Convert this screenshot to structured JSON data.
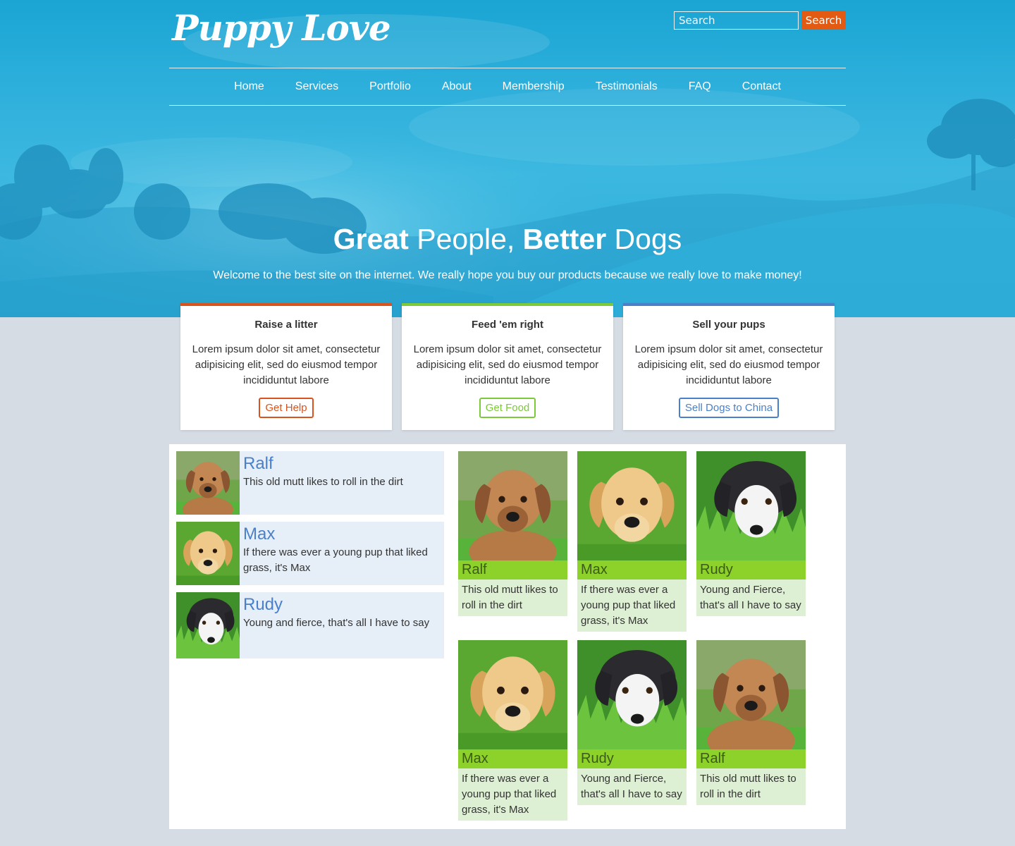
{
  "site": {
    "logo": "Puppy Love",
    "search_placeholder": "Search",
    "search_button": "Search"
  },
  "nav": [
    "Home",
    "Services",
    "Portfolio",
    "About",
    "Membership",
    "Testimonials",
    "FAQ",
    "Contact"
  ],
  "hero": {
    "headline_bold_1": "Great",
    "headline_normal_1": " People, ",
    "headline_bold_2": "Better",
    "headline_normal_2": " Dogs",
    "tagline": "Welcome to the best site on the internet. We really hope you buy our products because we really love to make money!"
  },
  "cards": [
    {
      "title": "Raise a litter",
      "body": "Lorem ipsum dolor sit amet, consectetur adipisicing elit, sed do eiusmod tempor incididuntut labore",
      "button": "Get Help",
      "color": "#d9531e"
    },
    {
      "title": "Feed 'em right",
      "body": "Lorem ipsum dolor sit amet, consectetur adipisicing elit, sed do eiusmod tempor incididuntut labore",
      "button": "Get Food",
      "color": "#7cc93a"
    },
    {
      "title": "Sell your pups",
      "body": "Lorem ipsum dolor sit amet, consectetur adipisicing elit, sed do eiusmod tempor incididuntut labore",
      "button": "Sell Dogs to China",
      "color": "#4a80c9"
    }
  ],
  "list": [
    {
      "name": "Ralf",
      "desc": "This old mutt likes to roll in the dirt",
      "dog": "ralf"
    },
    {
      "name": "Max",
      "desc": "If there was ever a young pup that liked grass, it's Max",
      "dog": "max"
    },
    {
      "name": "Rudy",
      "desc": "Young and fierce, that's all I have to say",
      "dog": "rudy"
    }
  ],
  "tiles": [
    {
      "name": "Ralf",
      "desc": "This old mutt likes to roll in the dirt",
      "dog": "ralf"
    },
    {
      "name": "Max",
      "desc": "If there was ever a young pup that liked grass, it's Max",
      "dog": "max"
    },
    {
      "name": "Rudy",
      "desc": "Young and Fierce, that's all I have to say",
      "dog": "rudy"
    },
    {
      "name": "Max",
      "desc": "If there was ever a young pup that liked grass, it's Max",
      "dog": "max"
    },
    {
      "name": "Rudy",
      "desc": "Young and Fierce, that's all I have to say",
      "dog": "rudy"
    },
    {
      "name": "Ralf",
      "desc": "This old mutt likes to roll in the dirt",
      "dog": "ralf"
    }
  ],
  "colors": {
    "accent": "#e35b12",
    "link_blue": "#4a80c9",
    "tile_green": "#8dd12b",
    "tile_bg": "#def0d3",
    "list_bg": "#e6eff7"
  }
}
